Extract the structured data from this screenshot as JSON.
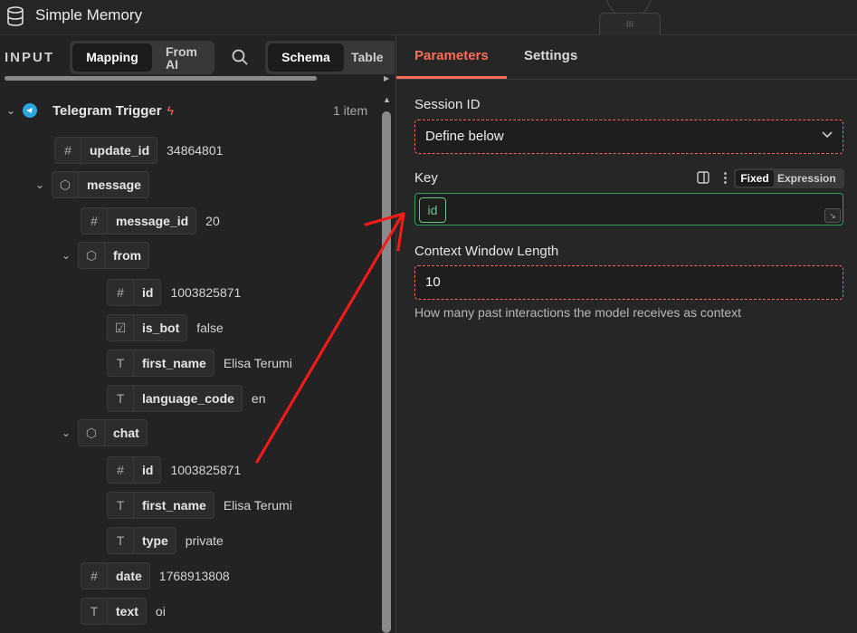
{
  "header": {
    "title": "Simple Memory",
    "title_icon": "database-icon",
    "drag_handle_label": "III"
  },
  "input_panel": {
    "label": "INPUT",
    "mode_tabs": [
      {
        "label": "Mapping",
        "active": true
      },
      {
        "label": "From AI",
        "active": false
      }
    ],
    "view_tabs": [
      {
        "label": "Schema",
        "active": true
      },
      {
        "label": "Table",
        "active": false
      }
    ],
    "node": {
      "name": "Telegram Trigger",
      "count": "1 item",
      "icon": "telegram-icon",
      "trigger_icon": "lightning-icon"
    },
    "tree": [
      {
        "type_icon": "#",
        "name": "update_id",
        "value": "34864801",
        "expandable": false
      },
      {
        "type_icon": "cube",
        "name": "message",
        "value": "",
        "expandable": true
      },
      {
        "type_icon": "#",
        "name": "message_id",
        "value": "20",
        "expandable": false
      },
      {
        "type_icon": "cube",
        "name": "from",
        "value": "",
        "expandable": true
      },
      {
        "type_icon": "#",
        "name": "id",
        "value": "1003825871",
        "expandable": false
      },
      {
        "type_icon": "checkbox",
        "name": "is_bot",
        "value": "false",
        "expandable": false
      },
      {
        "type_icon": "T",
        "name": "first_name",
        "value": "Elisa Terumi",
        "expandable": false
      },
      {
        "type_icon": "T",
        "name": "language_code",
        "value": "en",
        "expandable": false
      },
      {
        "type_icon": "cube",
        "name": "chat",
        "value": "",
        "expandable": true
      },
      {
        "type_icon": "#",
        "name": "id",
        "value": "1003825871",
        "expandable": false
      },
      {
        "type_icon": "T",
        "name": "first_name",
        "value": "Elisa Terumi",
        "expandable": false
      },
      {
        "type_icon": "T",
        "name": "type",
        "value": "private",
        "expandable": false
      },
      {
        "type_icon": "#",
        "name": "date",
        "value": "1768913808",
        "expandable": false
      },
      {
        "type_icon": "T",
        "name": "text",
        "value": "oi",
        "expandable": false
      }
    ]
  },
  "params_panel": {
    "tabs": [
      {
        "label": "Parameters",
        "active": true
      },
      {
        "label": "Settings",
        "active": false
      }
    ],
    "session_id": {
      "label": "Session ID",
      "value": "Define below"
    },
    "key": {
      "label": "Key",
      "token": "id",
      "mode_fixed": "Fixed",
      "mode_expression": "Expression"
    },
    "context_window": {
      "label": "Context Window Length",
      "value": "10",
      "hint": "How many past interactions the model receives as context"
    }
  },
  "colors": {
    "accent": "#ff6d5a",
    "valid_green": "#2f9e5a",
    "token_green": "#6bc58d",
    "annotation_arrow": "#ff1a1a",
    "telegram_blue": "#2aa6e0"
  }
}
